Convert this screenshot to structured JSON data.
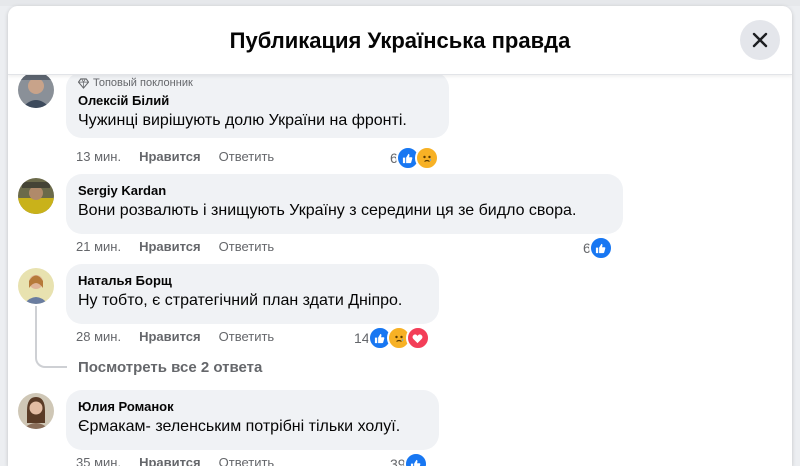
{
  "header": {
    "title": "Публикация Українська правда"
  },
  "comments": [
    {
      "badge": "Топовый поклонник",
      "author": "Олексій Білий",
      "text": "Чужинці вирішують долю України на фронті.",
      "time": "13 мин.",
      "like_label": "Нравится",
      "reply_label": "Ответить",
      "reaction_count": "6",
      "reactions": [
        "like",
        "sad"
      ]
    },
    {
      "author": "Sergiy Kardan",
      "text": "Вони розвалють і знищують Україну з середини ця зе бидло свора.",
      "time": "21 мин.",
      "like_label": "Нравится",
      "reply_label": "Ответить",
      "reaction_count": "6",
      "reactions": [
        "like"
      ]
    },
    {
      "author": "Наталья Борщ",
      "text": "Ну тобто, є стратегічний план здати Дніпро.",
      "time": "28 мин.",
      "like_label": "Нравится",
      "reply_label": "Ответить",
      "reaction_count": "14",
      "reactions": [
        "like",
        "sad",
        "love"
      ],
      "view_replies": "Посмотреть все 2 ответа"
    },
    {
      "author": "Юлия Романок",
      "text": "Єрмакам- зеленським потрібні тільки холуї.",
      "time": "35 мин.",
      "like_label": "Нравится",
      "reply_label": "Ответить",
      "reaction_count": "39",
      "reactions": [
        "like"
      ]
    }
  ],
  "colors": {
    "like": "#1877f2",
    "sad": "#f7b125",
    "love": "#f33e58",
    "bubble": "#f0f2f5"
  }
}
